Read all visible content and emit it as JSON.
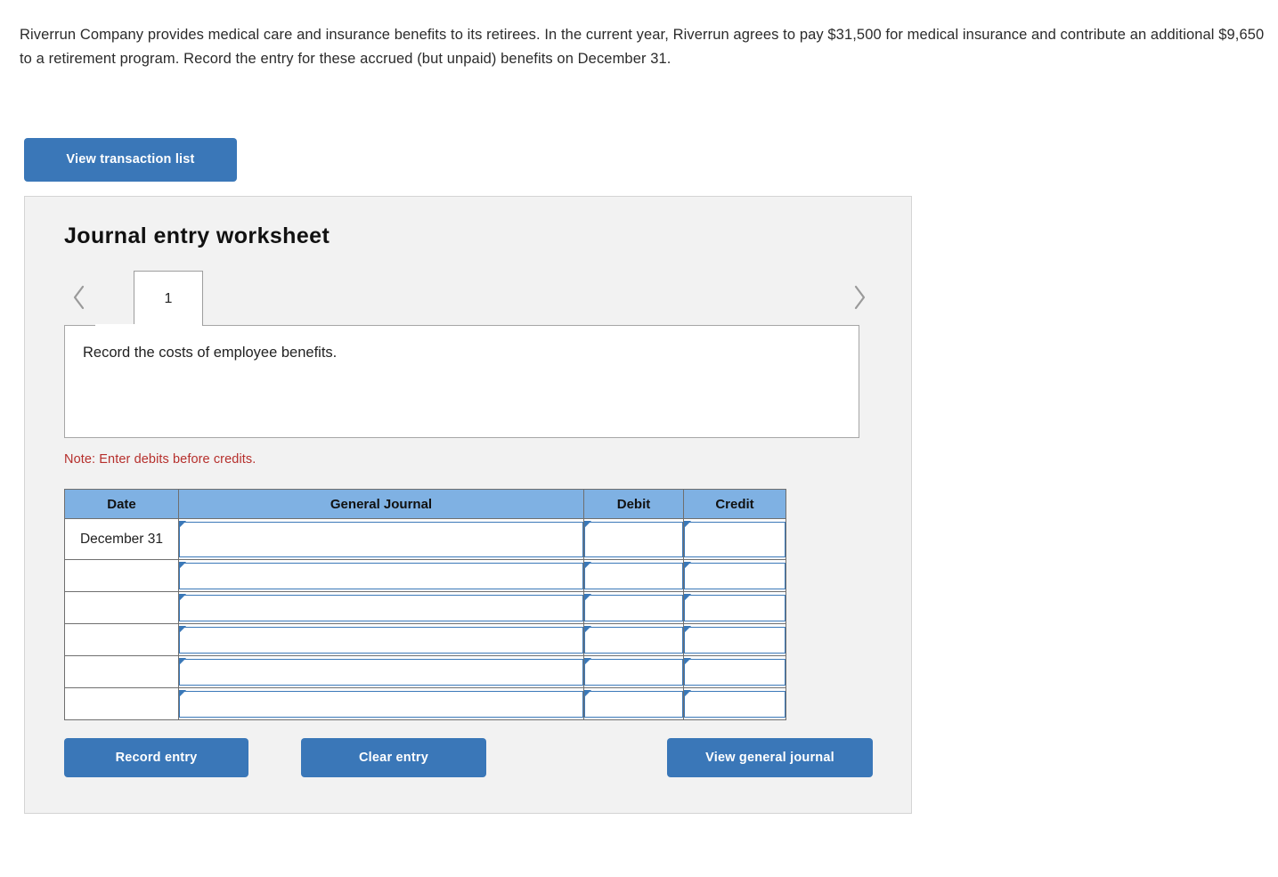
{
  "problem": {
    "text": "Riverrun Company provides medical care and insurance benefits to its retirees. In the current year, Riverrun agrees to pay $31,500 for medical insurance and contribute an additional $9,650 to a retirement program. Record the entry for these accrued (but unpaid) benefits on December 31."
  },
  "toolbar": {
    "view_transaction_list_label": "View transaction list"
  },
  "worksheet": {
    "title": "Journal entry worksheet",
    "tabs": [
      {
        "label": "1",
        "active": true
      }
    ],
    "prev_label": "‹",
    "next_label": "›",
    "description": "Record the costs of employee benefits.",
    "note": "Note: Enter debits before credits."
  },
  "table": {
    "headers": [
      "Date",
      "General Journal",
      "Debit",
      "Credit"
    ],
    "rows": [
      {
        "date": "December 31",
        "general_journal": "",
        "debit": "",
        "credit": ""
      },
      {
        "date": "",
        "general_journal": "",
        "debit": "",
        "credit": ""
      },
      {
        "date": "",
        "general_journal": "",
        "debit": "",
        "credit": ""
      },
      {
        "date": "",
        "general_journal": "",
        "debit": "",
        "credit": ""
      },
      {
        "date": "",
        "general_journal": "",
        "debit": "",
        "credit": ""
      },
      {
        "date": "",
        "general_journal": "",
        "debit": "",
        "credit": ""
      }
    ]
  },
  "actions": {
    "record_entry_label": "Record entry",
    "clear_entry_label": "Clear entry",
    "view_general_journal_label": "View general journal"
  },
  "colors": {
    "button_blue": "#3a77b8",
    "table_header_blue": "#7fb1e3",
    "field_border_blue": "#3a78b8",
    "note_red": "#b62f2c",
    "panel_bg": "#f2f2f2"
  }
}
